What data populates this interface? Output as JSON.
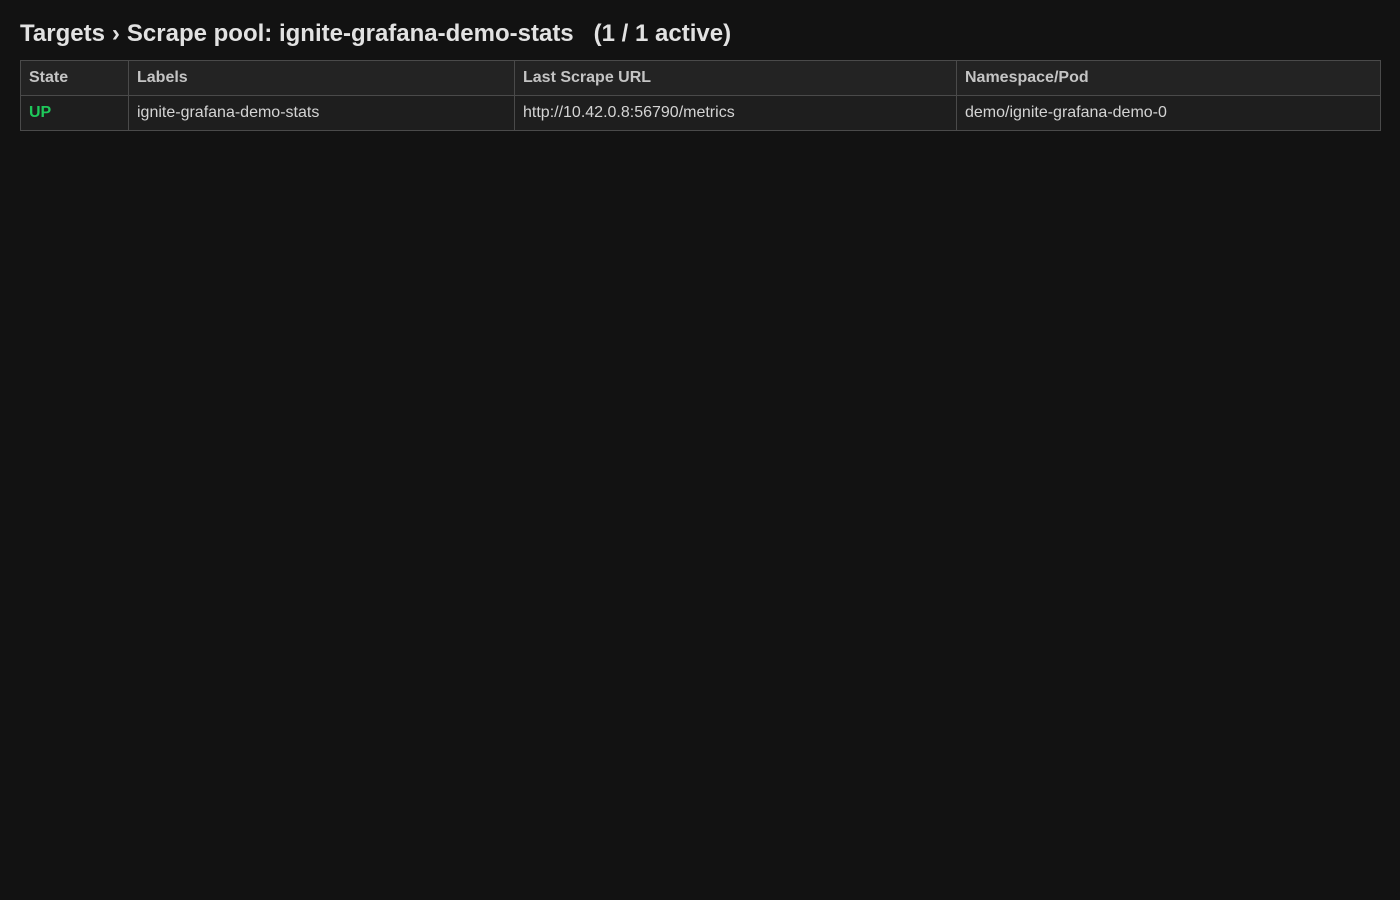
{
  "header": {
    "section": "Targets",
    "separator": "›",
    "pool_prefix": "Scrape pool:",
    "pool_name": "ignite-grafana-demo-stats",
    "active_count": "(1 / 1 active)"
  },
  "table": {
    "columns": [
      "State",
      "Labels",
      "Last Scrape URL",
      "Namespace/Pod"
    ],
    "rows": [
      {
        "state": "UP",
        "labels": "ignite-grafana-demo-stats",
        "url": "http://10.42.0.8:56790/metrics",
        "pod": "demo/ignite-grafana-demo-0"
      }
    ]
  },
  "colors": {
    "background": "#121212",
    "state_up": "#1ec85a"
  }
}
